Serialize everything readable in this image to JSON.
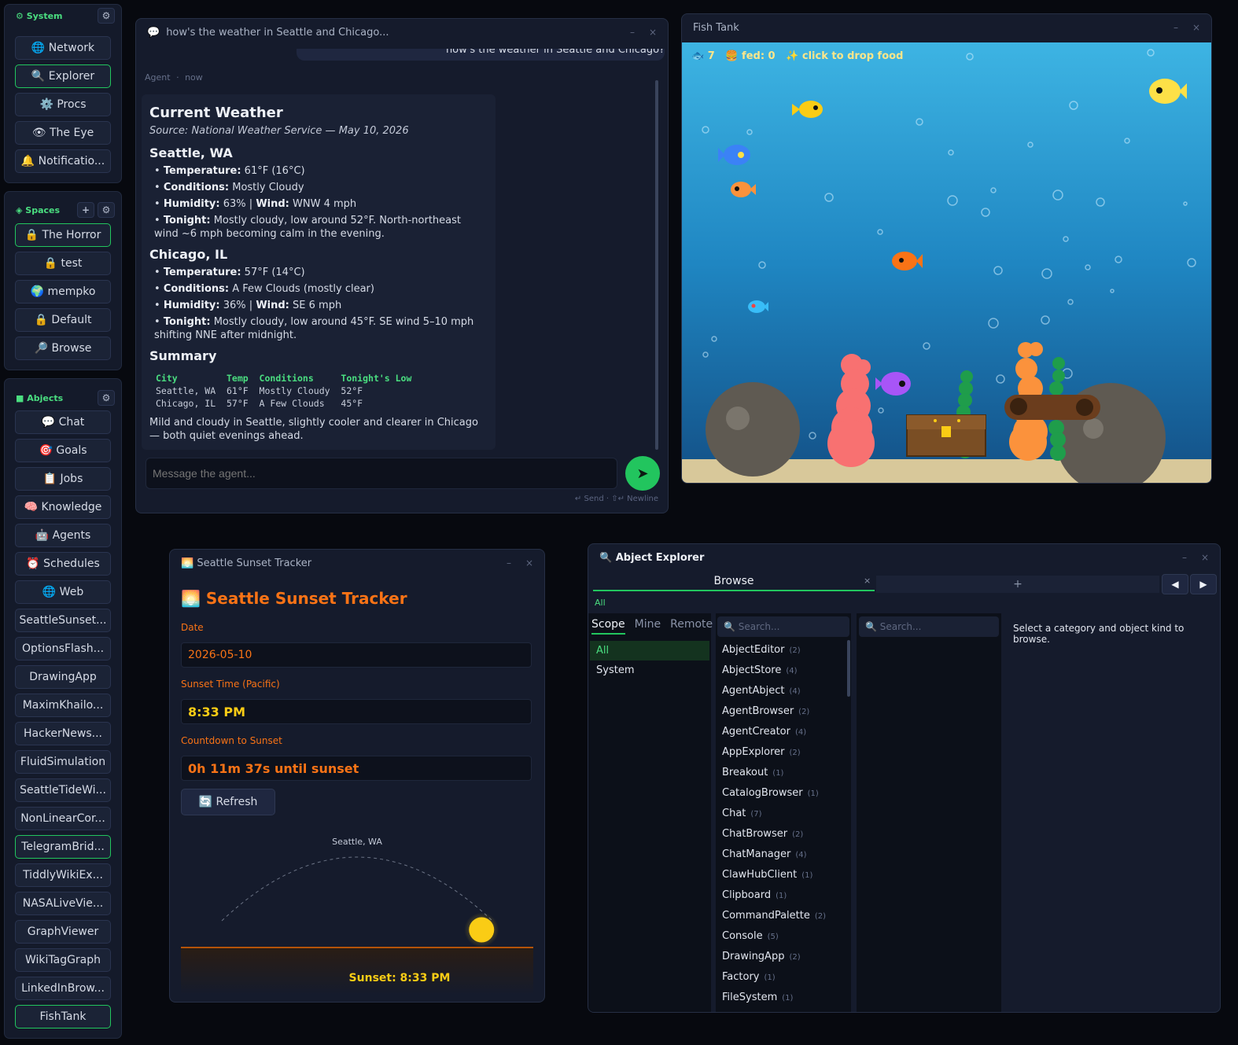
{
  "sidebar": {
    "system": {
      "header": "⚙ System",
      "items": [
        "🌐 Network",
        "🔍 Explorer",
        "⚙️ Procs",
        "👁 The Eye",
        "🔔 Notificatio..."
      ]
    },
    "spaces": {
      "header": "◈ Spaces",
      "add_label": "+",
      "items": [
        "🔒 The Horror",
        "🔒 test",
        "🌍 mempko",
        "🔒 Default",
        "🔎 Browse"
      ]
    },
    "abjects": {
      "header": "■ Abjects",
      "items": [
        "💬 Chat",
        "🎯 Goals",
        "📋 Jobs",
        "🧠 Knowledge",
        "🤖 Agents",
        "⏰ Schedules",
        "🌐 Web",
        "SeattleSunset...",
        "OptionsFlash...",
        "DrawingApp",
        "MaximKhailo...",
        "HackerNews...",
        "FluidSimulation",
        "SeattleTideWi...",
        "NonLinearCor...",
        "TelegramBrid...",
        "TiddlyWikiEx...",
        "NASALiveVie...",
        "GraphViewer",
        "WikiTagGraph",
        "LinkedInBrow...",
        "FishTank"
      ]
    },
    "gear": "⚙"
  },
  "chat": {
    "title": "how's the weather in Seattle and Chicago...",
    "sent_message": "how's the weather in Seattle and Chicago?",
    "meta_sender": "Agent",
    "meta_sep": "·",
    "meta_time": "now",
    "heading": "Current Weather",
    "source": "Source: National Weather Service — May 10, 2026",
    "seattle": {
      "title": "Seattle, WA",
      "temp_label": "Temperature:",
      "temp": "61°F (16°C)",
      "cond_label": "Conditions:",
      "cond": "Mostly Cloudy",
      "hum_label": "Humidity:",
      "hum": "63%",
      "sep": "|",
      "wind_label": "Wind:",
      "wind": "WNW 4 mph",
      "tonight_label": "Tonight:",
      "tonight": "Mostly cloudy, low around 52°F. North-northeast wind ~6 mph becoming calm in the evening."
    },
    "chicago": {
      "title": "Chicago, IL",
      "temp_label": "Temperature:",
      "temp": "57°F (14°C)",
      "cond_label": "Conditions:",
      "cond": "A Few Clouds (mostly clear)",
      "hum_label": "Humidity:",
      "hum": "36%",
      "sep": "|",
      "wind_label": "Wind:",
      "wind": "SE 6 mph",
      "tonight_label": "Tonight:",
      "tonight": "Mostly cloudy, low around 45°F. SE wind 5–10 mph shifting NNE after midnight."
    },
    "summary_title": "Summary",
    "summary_table": {
      "header": "City         Temp  Conditions     Tonight's Low",
      "rows": [
        "Seattle, WA  61°F  Mostly Cloudy  52°F",
        "Chicago, IL  57°F  A Few Clouds   45°F"
      ]
    },
    "closing": "Mild and cloudy in Seattle, slightly cooler and clearer in Chicago — both quiet evenings ahead.",
    "input_placeholder": "Message the agent...",
    "send_icon": "➤",
    "hint": "↵ Send  ·  ⇧↵ Newline"
  },
  "fishtank": {
    "title": "Fish Tank",
    "fish_count": "🐟 7",
    "fed": "🍔 fed: 0",
    "hint": "✨ click to drop food"
  },
  "sunset": {
    "window_title": "🌅 Seattle Sunset Tracker",
    "heading": "🌅 Seattle Sunset Tracker",
    "date_label": "Date",
    "date_value": "2026-05-10",
    "time_label": "Sunset Time (Pacific)",
    "time_value": "8:33 PM",
    "countdown_label": "Countdown to Sunset",
    "countdown_value": "0h 11m 37s until sunset",
    "refresh_label": "🔄 Refresh",
    "location": "Seattle, WA",
    "sunset_caption": "Sunset: 8:33 PM",
    "sun_progress": 0.96
  },
  "explorer": {
    "title": "🔍 Abject Explorer",
    "tab_label": "Browse",
    "tab_close": "×",
    "tab_add": "+",
    "back": "◀",
    "forward": "▶",
    "filter_all": "All",
    "scope_tabs": [
      "Scope",
      "Mine",
      "Remote"
    ],
    "scopes": [
      "All",
      "System"
    ],
    "search_placeholder": "🔍 Search...",
    "search_placeholder2": "🔍 Search...",
    "empty_message": "Select a category and object kind to browse.",
    "objects": [
      {
        "name": "AbjectEditor",
        "count": "(2)"
      },
      {
        "name": "AbjectStore",
        "count": "(4)"
      },
      {
        "name": "AgentAbject",
        "count": "(4)"
      },
      {
        "name": "AgentBrowser",
        "count": "(2)"
      },
      {
        "name": "AgentCreator",
        "count": "(4)"
      },
      {
        "name": "AppExplorer",
        "count": "(2)"
      },
      {
        "name": "Breakout",
        "count": "(1)"
      },
      {
        "name": "CatalogBrowser",
        "count": "(1)"
      },
      {
        "name": "Chat",
        "count": "(7)"
      },
      {
        "name": "ChatBrowser",
        "count": "(2)"
      },
      {
        "name": "ChatManager",
        "count": "(4)"
      },
      {
        "name": "ClawHubClient",
        "count": "(1)"
      },
      {
        "name": "Clipboard",
        "count": "(1)"
      },
      {
        "name": "CommandPalette",
        "count": "(2)"
      },
      {
        "name": "Console",
        "count": "(5)"
      },
      {
        "name": "DrawingApp",
        "count": "(2)"
      },
      {
        "name": "Factory",
        "count": "(1)"
      },
      {
        "name": "FileSystem",
        "count": "(1)"
      }
    ]
  },
  "window_controls": {
    "minimize": "–",
    "close": "×"
  },
  "colors": {
    "accent": "#22c55e",
    "sunset": "#f97316",
    "sun": "#facc15"
  }
}
